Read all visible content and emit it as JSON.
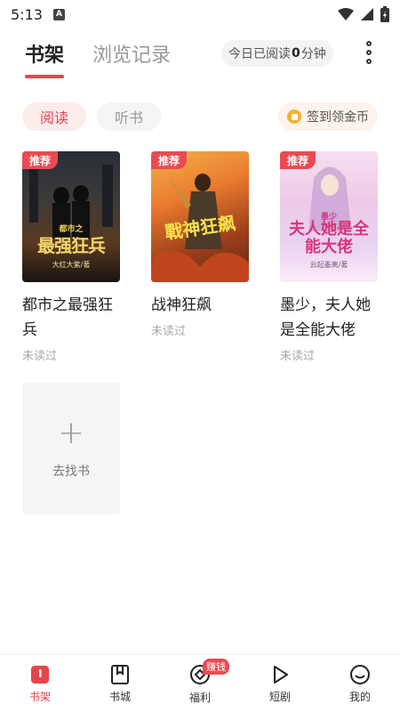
{
  "status_bar": {
    "time": "5:13",
    "notif_letter": "A"
  },
  "top_tabs": {
    "shelf": "书架",
    "history": "浏览记录"
  },
  "read_time": {
    "prefix": "今日已阅读",
    "minutes": "0",
    "suffix": "分钟"
  },
  "filters": {
    "read": "阅读",
    "listen": "听书"
  },
  "checkin": {
    "label": "签到领金币"
  },
  "books": [
    {
      "title": "都市之最强狂兵",
      "status": "未读过",
      "badge": "推荐",
      "cover_text": "最强狂兵",
      "cover_subtext": "都市之",
      "cover_author": "大红大紫/著"
    },
    {
      "title": "战神狂飙",
      "status": "未读过",
      "badge": "推荐",
      "cover_text": "戰神狂飙"
    },
    {
      "title": "墨少，夫人她是全能大佬",
      "status": "未读过",
      "badge": "推荐",
      "cover_text": "夫人她是全能大佬",
      "cover_subtext": "墨少",
      "cover_author": "云起墨离/著"
    }
  ],
  "add_book": {
    "label": "去找书"
  },
  "bottom_nav": [
    {
      "label": "书架",
      "icon": "bookshelf-icon",
      "active": true
    },
    {
      "label": "书城",
      "icon": "bookstore-icon",
      "active": false
    },
    {
      "label": "福利",
      "icon": "welfare-icon",
      "active": false,
      "badge": "赚钱"
    },
    {
      "label": "短剧",
      "icon": "play-icon",
      "active": false
    },
    {
      "label": "我的",
      "icon": "profile-icon",
      "active": false
    }
  ],
  "colors": {
    "accent": "#e8434c",
    "badge": "#ea4a53",
    "coin": "#f6b12d"
  }
}
